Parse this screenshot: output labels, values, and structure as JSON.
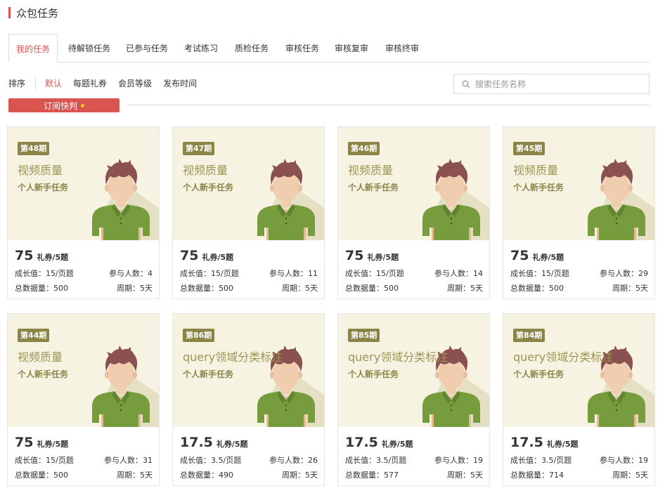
{
  "page": {
    "title": "众包任务",
    "accent_color": "#d9534f"
  },
  "tabs": [
    {
      "label": "我的任务",
      "active": true
    },
    {
      "label": "待解锁任务"
    },
    {
      "label": "已参与任务"
    },
    {
      "label": "考试练习"
    },
    {
      "label": "质检任务"
    },
    {
      "label": "审核任务"
    },
    {
      "label": "审核复审"
    },
    {
      "label": "审核终审"
    }
  ],
  "sort": {
    "label": "排序",
    "options": [
      {
        "label": "默认",
        "active": true
      },
      {
        "label": "每题礼券"
      },
      {
        "label": "会员等级"
      },
      {
        "label": "发布时间"
      }
    ]
  },
  "search": {
    "placeholder": "搜索任务名称",
    "icon": "search-icon"
  },
  "subscribe": {
    "label": "订阅快判"
  },
  "cards": [
    {
      "period": "第48期",
      "title": "视频质量",
      "subtitle": "个人新手任务",
      "reward": "75",
      "unit": "礼券/5题",
      "growth": "成长值：15/页题",
      "participants": "参与人数：4",
      "total": "总数据量：500",
      "cycle": "周期：5天"
    },
    {
      "period": "第47期",
      "title": "视频质量",
      "subtitle": "个人新手任务",
      "reward": "75",
      "unit": "礼券/5题",
      "growth": "成长值：15/页题",
      "participants": "参与人数：11",
      "total": "总数据量：500",
      "cycle": "周期：5天"
    },
    {
      "period": "第46期",
      "title": "视频质量",
      "subtitle": "个人新手任务",
      "reward": "75",
      "unit": "礼券/5题",
      "growth": "成长值：15/页题",
      "participants": "参与人数：14",
      "total": "总数据量：500",
      "cycle": "周期：5天"
    },
    {
      "period": "第45期",
      "title": "视频质量",
      "subtitle": "个人新手任务",
      "reward": "75",
      "unit": "礼券/5题",
      "growth": "成长值：15/页题",
      "participants": "参与人数：29",
      "total": "总数据量：500",
      "cycle": "周期：5天"
    },
    {
      "period": "第44期",
      "title": "视频质量",
      "subtitle": "个人新手任务",
      "reward": "75",
      "unit": "礼券/5题",
      "growth": "成长值：15/页题",
      "participants": "参与人数：31",
      "total": "总数据量：500",
      "cycle": "周期：5天"
    },
    {
      "period": "第86期",
      "title": "query领域分类标注",
      "subtitle": "个人新手任务",
      "reward": "17.5",
      "unit": "礼券/5题",
      "growth": "成长值：3.5/页题",
      "participants": "参与人数：26",
      "total": "总数据量：490",
      "cycle": "周期：5天"
    },
    {
      "period": "第85期",
      "title": "query领域分类标注",
      "subtitle": "个人新手任务",
      "reward": "17.5",
      "unit": "礼券/5题",
      "growth": "成长值：3.5/页题",
      "participants": "参与人数：19",
      "total": "总数据量：577",
      "cycle": "周期：5天"
    },
    {
      "period": "第84期",
      "title": "query领域分类标注",
      "subtitle": "个人新手任务",
      "reward": "17.5",
      "unit": "礼券/5题",
      "growth": "成长值：3.5/页题",
      "participants": "参与人数：19",
      "total": "总数据量：714",
      "cycle": "周期：5天"
    }
  ]
}
